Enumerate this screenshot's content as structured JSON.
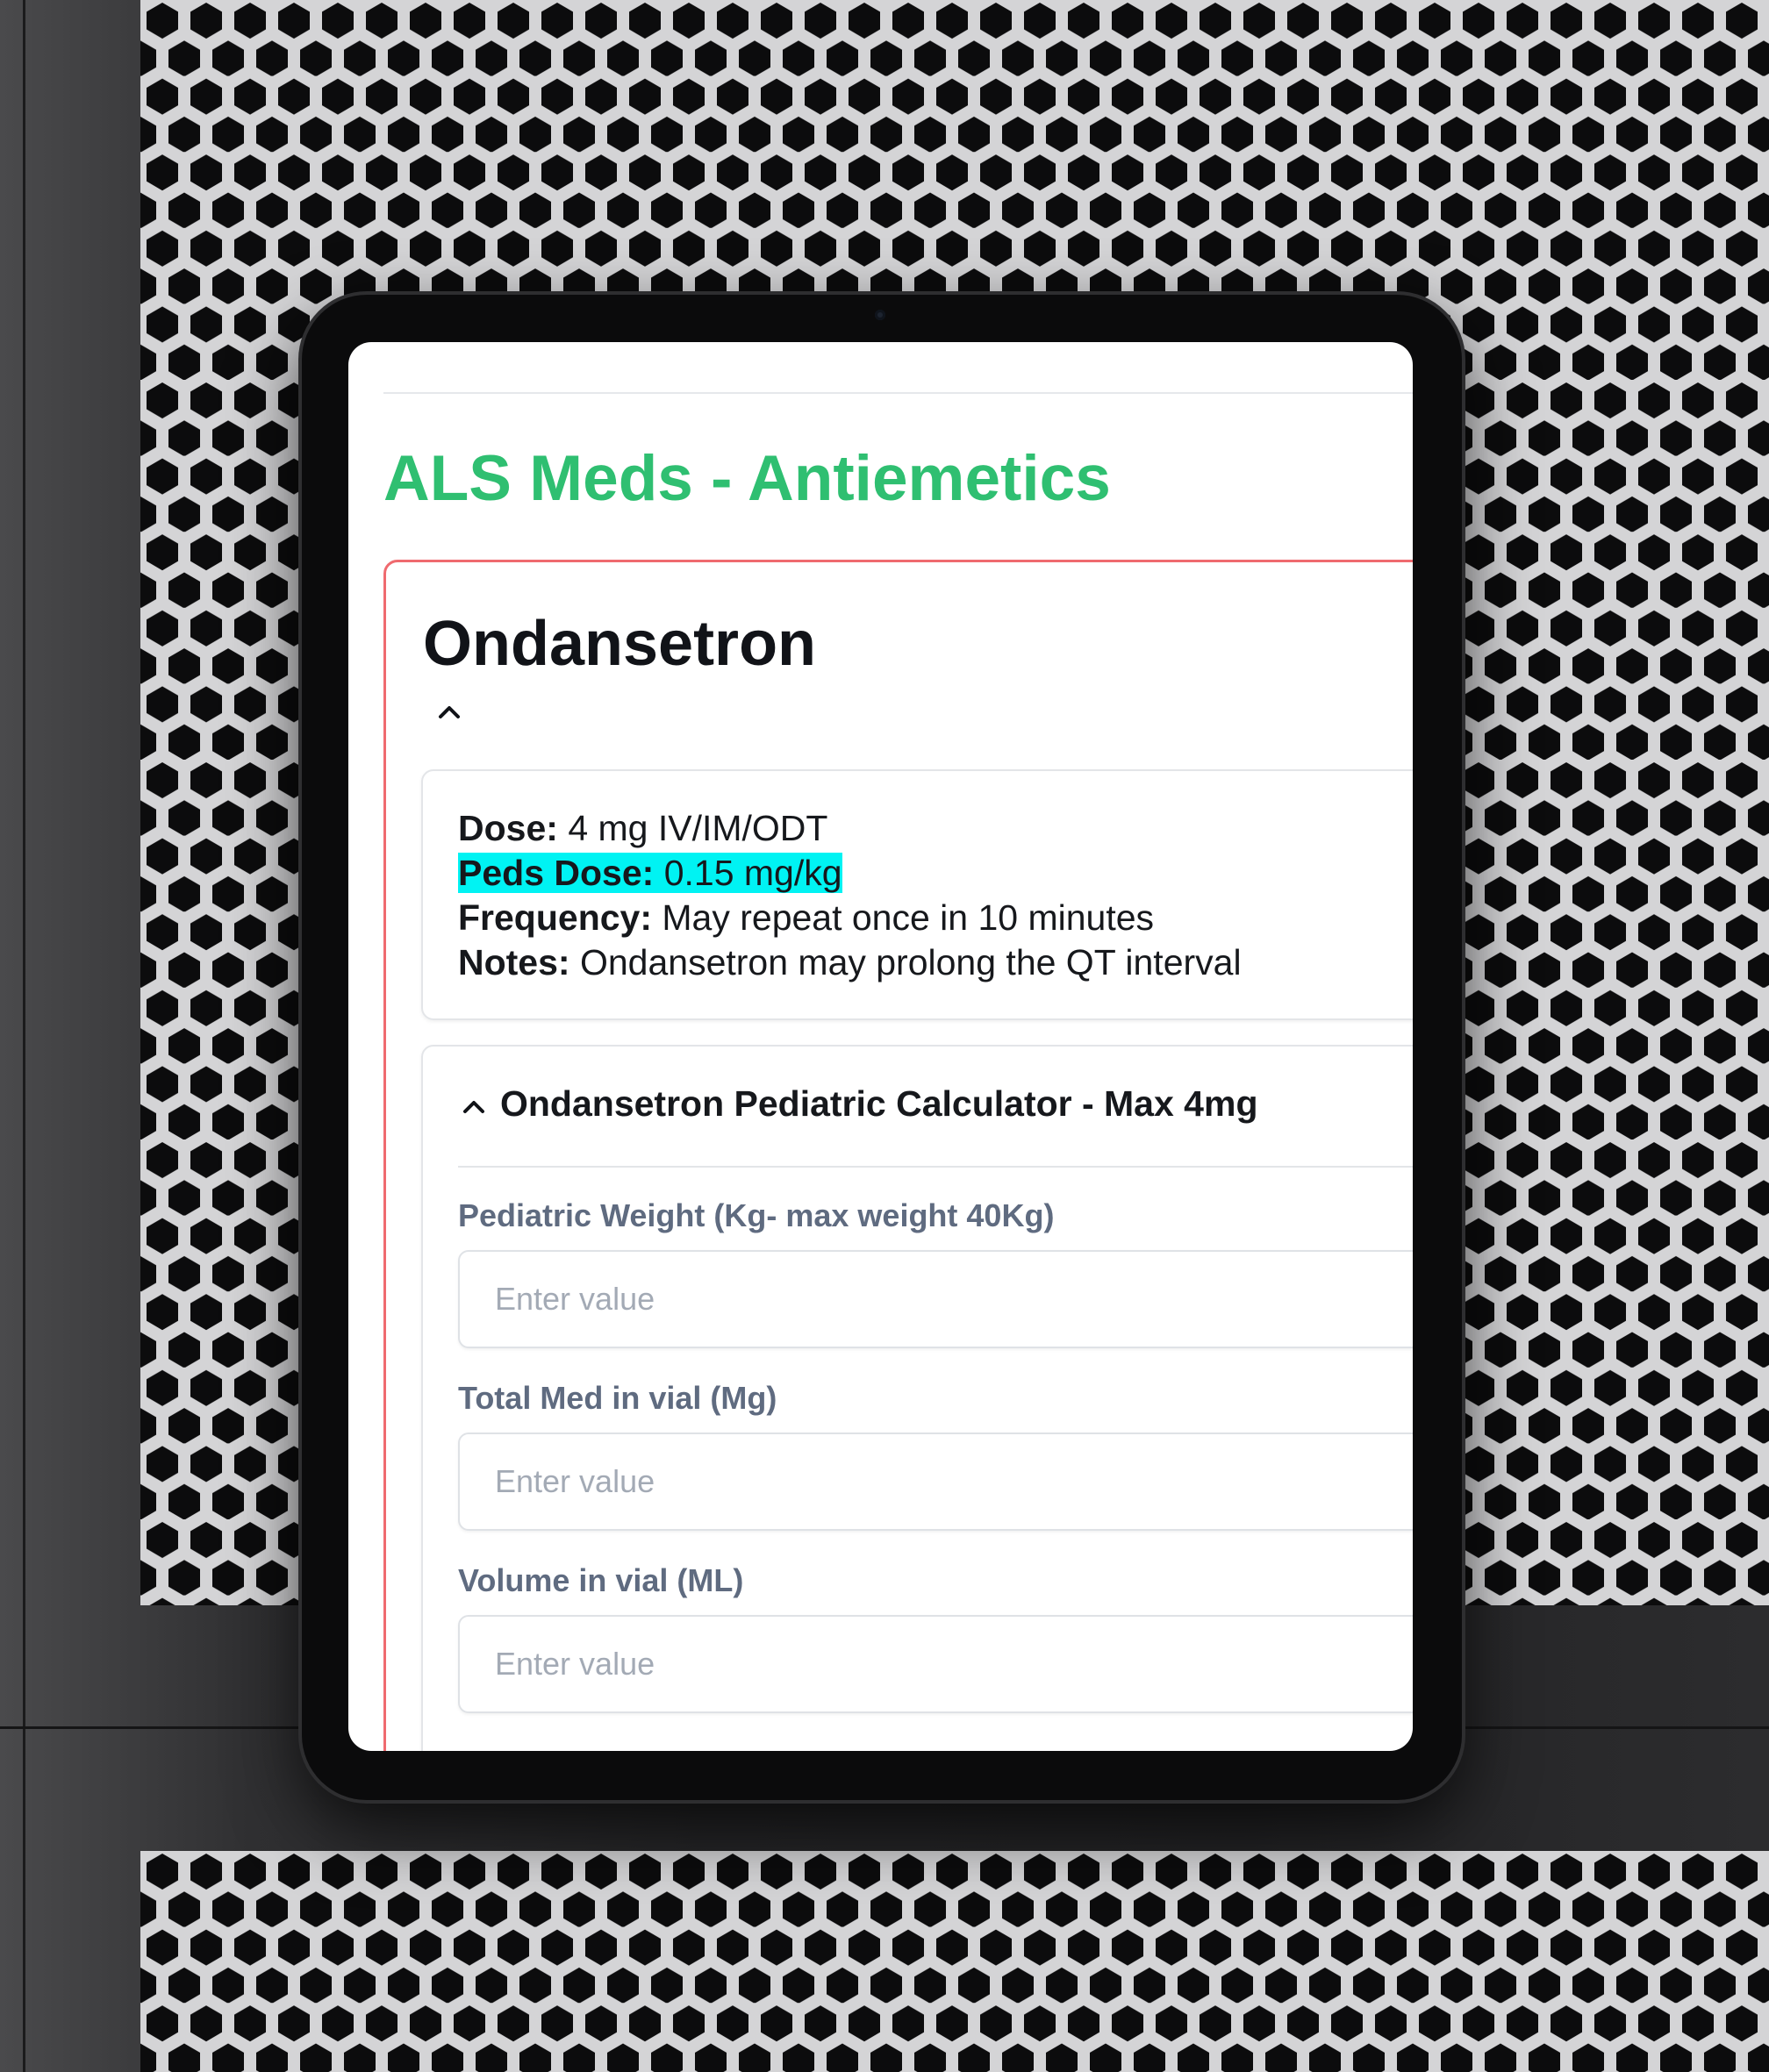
{
  "page": {
    "title": "ALS Meds - Antiemetics",
    "accent_color": "#2fbf71",
    "card_border_color": "#ef6a6f"
  },
  "medication": {
    "name": "Ondansetron",
    "toggle_icon": "chevron-up-icon",
    "details": {
      "dose_label": "Dose:",
      "dose_value": " 4 mg IV/IM/ODT",
      "peds_label": "Peds Dose:",
      "peds_value": " 0.15 mg/kg",
      "highlight_color": "#00f3f3",
      "frequency_label": "Frequency:",
      "frequency_value": " May repeat once in 10 minutes",
      "notes_label": "Notes:",
      "notes_value": " Ondansetron may prolong the QT interval"
    }
  },
  "calculator": {
    "title": "Ondansetron Pediatric Calculator - Max 4mg",
    "toggle_icon": "chevron-up-icon",
    "fields": [
      {
        "label": "Pediatric Weight (Kg- max weight 40Kg)",
        "placeholder": "Enter value",
        "value": ""
      },
      {
        "label": "Total Med in vial (Mg)",
        "placeholder": "Enter value",
        "value": ""
      },
      {
        "label": "Volume in vial (ML)",
        "placeholder": "Enter value",
        "value": ""
      }
    ]
  }
}
